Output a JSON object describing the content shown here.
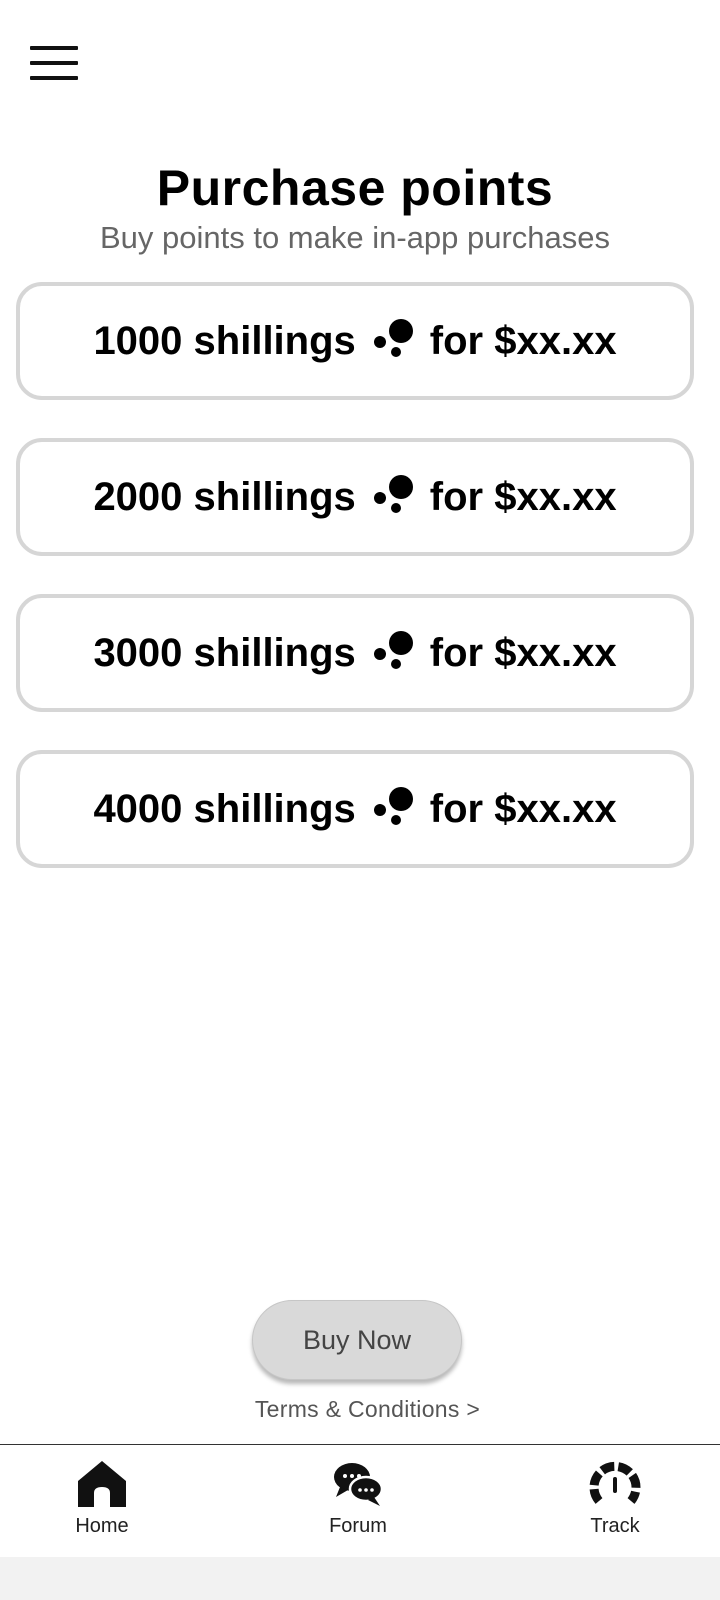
{
  "header": {
    "menu_icon": "hamburger-menu-icon"
  },
  "page": {
    "title": "Purchase points",
    "subtitle": "Buy points to make in-app purchases"
  },
  "options": [
    {
      "amount": "1000 shillings",
      "price": "for $xx.xx",
      "icon": "coins-icon"
    },
    {
      "amount": "2000 shillings",
      "price": "for $xx.xx",
      "icon": "coins-icon"
    },
    {
      "amount": "3000 shillings",
      "price": "for $xx.xx",
      "icon": "coins-icon"
    },
    {
      "amount": "4000 shillings",
      "price": "for $xx.xx",
      "icon": "coins-icon"
    }
  ],
  "actions": {
    "buy_label": "Buy Now",
    "terms_label": "Terms & Conditions >"
  },
  "tabbar": {
    "items": [
      {
        "label": "Home",
        "icon": "home-icon"
      },
      {
        "label": "Forum",
        "icon": "chat-bubbles-icon"
      },
      {
        "label": "Track",
        "icon": "speedometer-icon"
      }
    ]
  },
  "colors": {
    "card_border": "#d6d6d6",
    "button_bg": "#d9d9d9",
    "subtitle_text": "#666666"
  }
}
